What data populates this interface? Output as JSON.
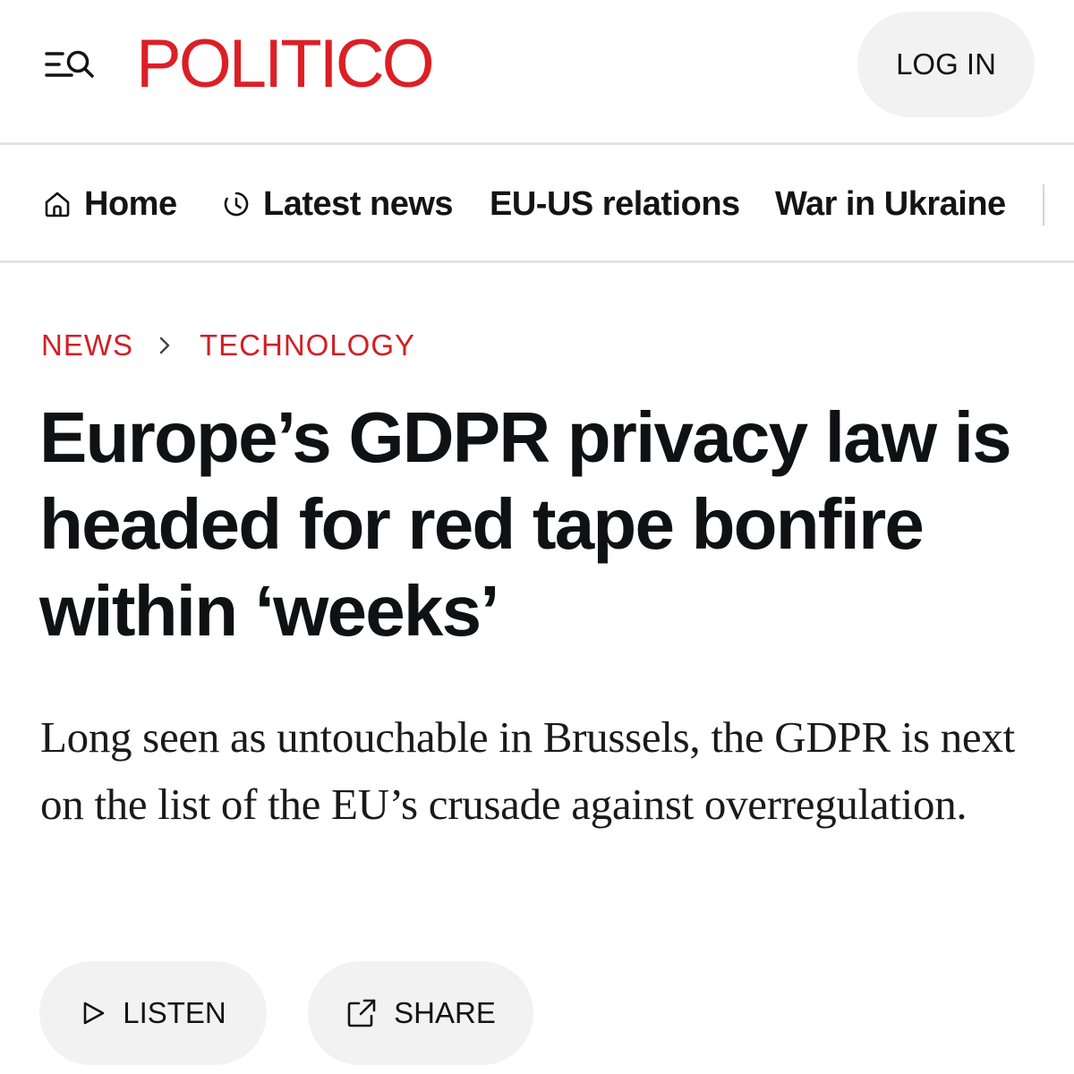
{
  "header": {
    "logo_text": "POLITICO",
    "login_label": "LOG IN",
    "menu_icon": "menu-search-icon",
    "brand_color": "#dc1f26"
  },
  "nav": {
    "items": [
      {
        "label": "Home",
        "icon": "home-icon"
      },
      {
        "label": "Latest news",
        "icon": "clock-icon"
      },
      {
        "label": "EU-US relations"
      },
      {
        "label": "War in Ukraine"
      }
    ]
  },
  "breadcrumb": {
    "items": [
      "NEWS",
      "TECHNOLOGY"
    ],
    "separator_icon": "chevron-right-icon",
    "color": "#d21f26"
  },
  "article": {
    "headline": "Europe’s GDPR privacy law is headed for red tape bonfire within ‘weeks’",
    "dek": "Long seen as untouchable in Brussels, the GDPR is next on the list of the EU’s crusade against overregulation."
  },
  "actions": {
    "listen_label": "LISTEN",
    "listen_icon": "play-icon",
    "share_label": "SHARE",
    "share_icon": "share-icon"
  }
}
